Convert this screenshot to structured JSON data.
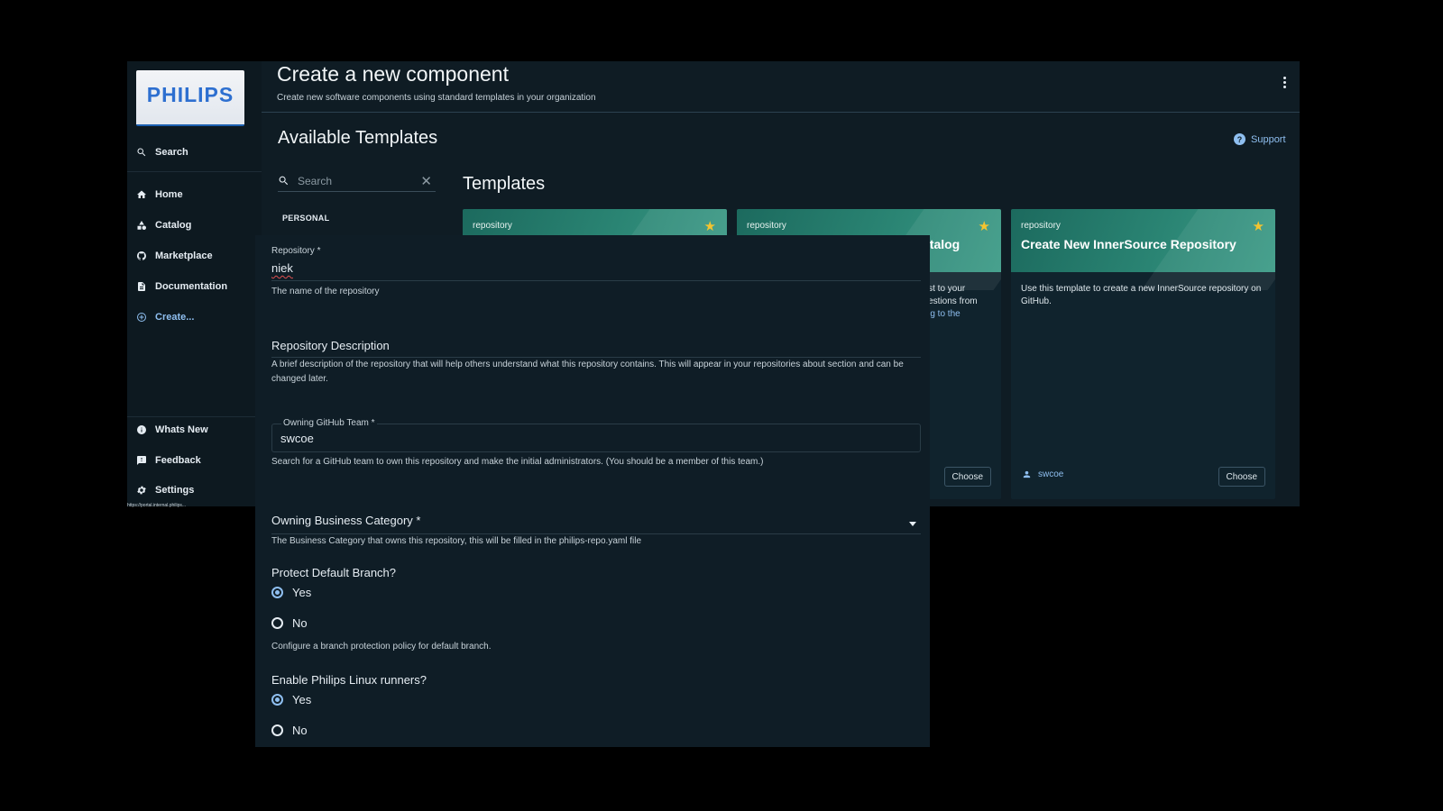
{
  "sidebar": {
    "logo_text": "PHILIPS",
    "search_label": "Search",
    "items": [
      {
        "label": "Home",
        "icon": "home-icon"
      },
      {
        "label": "Catalog",
        "icon": "catalog-icon"
      },
      {
        "label": "Marketplace",
        "icon": "github-icon"
      },
      {
        "label": "Documentation",
        "icon": "document-icon"
      },
      {
        "label": "Create...",
        "icon": "add-circle-icon"
      }
    ],
    "bottom_items": [
      {
        "label": "Whats New",
        "icon": "info-icon"
      },
      {
        "label": "Feedback",
        "icon": "feedback-icon"
      },
      {
        "label": "Settings",
        "icon": "gear-icon"
      }
    ]
  },
  "header": {
    "title": "Create a new component",
    "subtitle": "Create new software components using standard templates in your organization"
  },
  "content": {
    "available_title": "Available Templates",
    "support_label": "Support",
    "search_placeholder": "Search",
    "personal_label": "PERSONAL",
    "templates_title": "Templates"
  },
  "cards": [
    {
      "type": "repository",
      "title": "",
      "desc": "",
      "owner": "",
      "choose": ""
    },
    {
      "type": "repository",
      "title": "atalog",
      "desc_lines": [
        "uest to your",
        "questions from"
      ],
      "desc_link": "ding to the",
      "choose": "Choose"
    },
    {
      "type": "repository",
      "title": "Create New InnerSource Repository",
      "desc": "Use this template to create a new InnerSource repository on GitHub.",
      "owner": "swcoe",
      "choose": "Choose"
    }
  ],
  "form": {
    "repository": {
      "label": "Repository *",
      "value": "niek",
      "help": "The name of the repository"
    },
    "description": {
      "title": "Repository Description",
      "help": "A brief description of the repository that will help others understand what this repository contains. This will appear in your repositories about section and can be changed later."
    },
    "team": {
      "label": "Owning GitHub Team *",
      "value": "swcoe",
      "help": "Search for a GitHub team to own this repository and make the initial administrators. (You should be a member of this team.)"
    },
    "category": {
      "title": "Owning Business Category *",
      "help": "The Business Category that owns this repository, this will be filled in the philips-repo.yaml file"
    },
    "protect": {
      "title": "Protect Default Branch?",
      "yes": "Yes",
      "no": "No",
      "selected": "Yes",
      "help": "Configure a branch protection policy for default branch."
    },
    "runners": {
      "title": "Enable Philips Linux runners?",
      "yes": "Yes",
      "no": "No",
      "selected": "Yes"
    }
  },
  "colors": {
    "accent": "#8fbff0",
    "card_band": "#2a8473",
    "star": "#f4c430",
    "background": "#0f1c24"
  }
}
